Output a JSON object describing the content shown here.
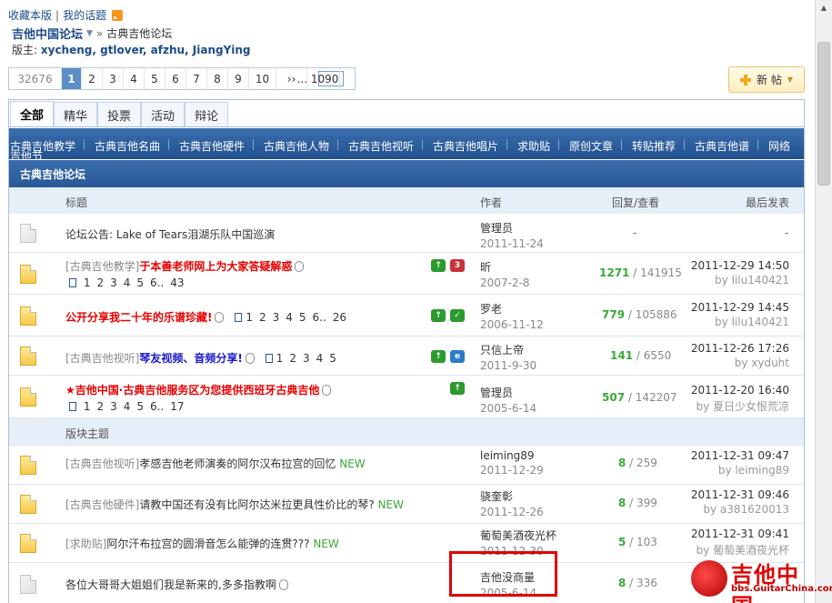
{
  "header": {
    "bookmark": "收藏本版",
    "my_topics": "我的话题",
    "forum_name": "吉他中国论坛",
    "crumb_sep": "»",
    "current_board": "古典吉他论坛",
    "mods_label": "版主:",
    "mods": "xycheng, gtlover, afzhu, JiangYing"
  },
  "pager": {
    "total": "32676",
    "current": "1",
    "pages": [
      "2",
      "3",
      "4",
      "5",
      "6",
      "7",
      "8",
      "9",
      "10"
    ],
    "next": "››",
    "last": "... 1090"
  },
  "new_post_label": "新 帖",
  "type_tabs": [
    "全部",
    "精华",
    "投票",
    "活动",
    "辩论"
  ],
  "categories": [
    "古典吉他教学",
    "古典吉他名曲",
    "古典吉他硬件",
    "古典吉他人物",
    "古典吉他视听",
    "古典吉他唱片",
    "求助贴",
    "原创文章",
    "转贴推荐",
    "古典吉他谱",
    "网络",
    "吉他节"
  ],
  "forum_title": "古典吉他论坛",
  "columns": {
    "title": "标题",
    "author": "作者",
    "stats": "回复/查看",
    "last": "最后发表"
  },
  "announcement": {
    "title": "论坛公告: Lake of Tears泪湖乐队中国巡演",
    "author": "管理员",
    "date": "2011-11-24",
    "stats": "-",
    "last": "-"
  },
  "sticky": [
    {
      "tag": "[古典吉他教学]",
      "title": "于本善老师网上为大家答疑解惑",
      "pages": [
        "1",
        "2",
        "3",
        "4",
        "5",
        "6..",
        "43"
      ],
      "badge2": "3",
      "author": "昕",
      "date": "2007-2-8",
      "replies": "1271",
      "views": "141915",
      "last_time": "2011-12-29 14:50",
      "last_by": "by lilu140421"
    },
    {
      "tag": "",
      "title": "公开分享我二十年的乐谱珍藏!",
      "pages": [
        "1",
        "2",
        "3",
        "4",
        "5",
        "6..",
        "26"
      ],
      "badge2": "",
      "author": "罗老",
      "date": "2006-11-12",
      "replies": "779",
      "views": "105886",
      "last_time": "2011-12-29 14:45",
      "last_by": "by lilu140421"
    },
    {
      "tag": "[古典吉他视听]",
      "title": "琴友视频、音频分享!",
      "pages": [
        "1",
        "2",
        "3",
        "4",
        "5"
      ],
      "badge2": "e",
      "author": "只信上帝",
      "date": "2011-9-30",
      "replies": "141",
      "views": "6550",
      "last_time": "2011-12-26 17:26",
      "last_by": "by xyduht"
    },
    {
      "tag": "",
      "title": "吉他中国·古典吉他服务区为您提供西班牙古典吉他",
      "pages": [
        "1",
        "2",
        "3",
        "4",
        "5",
        "6..",
        "17"
      ],
      "badge2": "",
      "author": "管理员",
      "date": "2005-6-14",
      "replies": "507",
      "views": "142207",
      "last_time": "2011-12-20 16:40",
      "last_by": "by 夏日少女恨荒凉"
    }
  ],
  "section_label": "版块主题",
  "threads": [
    {
      "tag": "[古典吉他视听]",
      "title": "孝感吉他老师演奏的阿尔汉布拉宫的回忆",
      "new": "NEW",
      "author": "leiming89",
      "date": "2011-12-29",
      "replies": "8",
      "views": "259",
      "last_time": "2011-12-31 09:47",
      "last_by": "by leiming89"
    },
    {
      "tag": "[古典吉他硬件]",
      "title": "请教中国还有没有比阿尔达米拉更具性价比的琴?",
      "new": "NEW",
      "author": "骁奎彰",
      "date": "2011-12-26",
      "replies": "8",
      "views": "399",
      "last_time": "2011-12-31 09:46",
      "last_by": "by a381620013"
    },
    {
      "tag": "[求助贴]",
      "title": "阿尔汗布拉宫的圆滑音怎么能弹的连贯???",
      "new": "NEW",
      "author": "葡萄美酒夜光杯",
      "date": "2011-12-30",
      "replies": "5",
      "views": "103",
      "last_time": "2011-12-31 09:41",
      "last_by": "by 葡萄美酒夜光杯"
    },
    {
      "tag": "",
      "title": "各位大哥哥大姐姐们我是新来的,多多指教啊",
      "new": "",
      "author": "吉他没商量",
      "date": "2005-6-14",
      "replies": "8",
      "views": "336",
      "last_time": "",
      "last_by": ""
    }
  ],
  "watermark": {
    "text": "吉他中国",
    "url": "bbs.GuitarChina.com"
  }
}
